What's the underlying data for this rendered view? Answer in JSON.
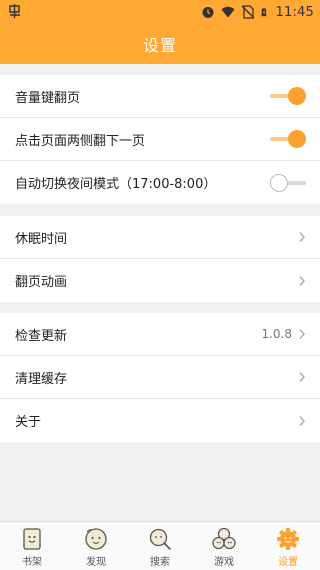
{
  "status_bar": {
    "time": "11:45",
    "icons": [
      "app-icon",
      "alarm-icon",
      "wifi-icon",
      "no-sim-icon",
      "battery-icon"
    ]
  },
  "header": {
    "title": "设置"
  },
  "groups": [
    {
      "rows": [
        {
          "label": "音量键翻页",
          "type": "switch",
          "on": true
        },
        {
          "label": "点击页面两侧翻下一页",
          "type": "switch",
          "on": true
        },
        {
          "label": "自动切换夜间模式（17:00-8:00）",
          "type": "switch",
          "on": false
        }
      ]
    },
    {
      "rows": [
        {
          "label": "休眠时间",
          "type": "link"
        },
        {
          "label": "翻页动画",
          "type": "link"
        }
      ]
    },
    {
      "rows": [
        {
          "label": "检查更新",
          "type": "link",
          "value": "1.0.8"
        },
        {
          "label": "清理缓存",
          "type": "link"
        },
        {
          "label": "关于",
          "type": "link"
        }
      ]
    }
  ],
  "bottom_nav": [
    {
      "label": "书架",
      "icon": "bookshelf-icon",
      "active": false
    },
    {
      "label": "发现",
      "icon": "discover-icon",
      "active": false
    },
    {
      "label": "搜索",
      "icon": "search-icon",
      "active": false
    },
    {
      "label": "游戏",
      "icon": "game-icon",
      "active": false
    },
    {
      "label": "设置",
      "icon": "settings-gear-icon",
      "active": true
    }
  ],
  "colors": {
    "accent": "#ffa833",
    "switch_on": "#ffa12e",
    "active_tab": "#ff9a1f"
  }
}
